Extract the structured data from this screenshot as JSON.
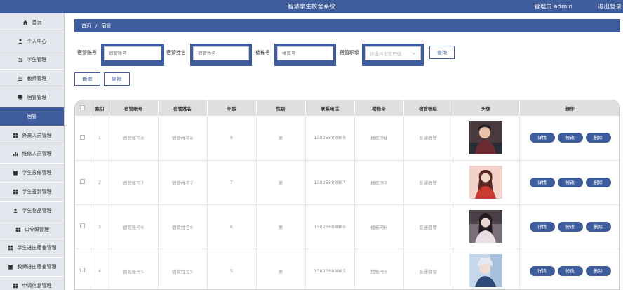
{
  "app": {
    "title": "智慧学生校舍系统",
    "user": "管理员 admin",
    "logout": "退出登录"
  },
  "sidebar": {
    "items": [
      {
        "label": "首页",
        "icon": "home-icon"
      },
      {
        "label": "个人中心",
        "icon": "user-icon"
      },
      {
        "label": "学生管理",
        "icon": "sliders-icon"
      },
      {
        "label": "教师管理",
        "icon": "list-icon"
      },
      {
        "label": "宿管管理",
        "icon": "monitor-icon"
      },
      {
        "label": "宿管",
        "icon": ""
      },
      {
        "label": "外来人员管理",
        "icon": "grid-icon"
      },
      {
        "label": "维修人员管理",
        "icon": "bar-chart-icon"
      },
      {
        "label": "学生报修管理",
        "icon": "clipboard-icon"
      },
      {
        "label": "学生签到管理",
        "icon": "grid-icon"
      },
      {
        "label": "学生物品管理",
        "icon": "user-icon"
      },
      {
        "label": "口令码管理",
        "icon": "grid-icon"
      },
      {
        "label": "学生进出宿舍管理",
        "icon": "grid-icon"
      },
      {
        "label": "教师进出宿舍管理",
        "icon": "clipboard-icon"
      },
      {
        "label": "申请信息管理",
        "icon": "grid-icon"
      }
    ],
    "active_index": 5
  },
  "breadcrumb": {
    "home": "首页",
    "sep": "/",
    "current": "宿管"
  },
  "search": {
    "fields": [
      {
        "label": "宿管账号",
        "placeholder": "宿管账号"
      },
      {
        "label": "宿管姓名",
        "placeholder": "宿管姓名"
      },
      {
        "label": "楼栋号",
        "placeholder": "楼栋号"
      }
    ],
    "level": {
      "label": "宿管职级",
      "placeholder": "请选择宿管职级"
    },
    "query_label": "查询"
  },
  "actions": {
    "add": "新增",
    "delete": "删除"
  },
  "table": {
    "headers": [
      "",
      "索引",
      "宿管账号",
      "宿管姓名",
      "年龄",
      "性别",
      "联系电话",
      "楼栋号",
      "宿管职级",
      "头像",
      "操作"
    ],
    "rows": [
      {
        "index": "1",
        "account": "宿管账号8",
        "name": "宿管姓名8",
        "age": "8",
        "gender": "男",
        "phone": "13823888888",
        "building": "楼栋号8",
        "level": "普通宿管"
      },
      {
        "index": "2",
        "account": "宿管账号7",
        "name": "宿管姓名7",
        "age": "7",
        "gender": "男",
        "phone": "13823888887",
        "building": "楼栋号7",
        "level": "普通宿管"
      },
      {
        "index": "3",
        "account": "宿管账号6",
        "name": "宿管姓名6",
        "age": "6",
        "gender": "男",
        "phone": "13823888886",
        "building": "楼栋号6",
        "level": "普通宿管"
      },
      {
        "index": "4",
        "account": "宿管账号5",
        "name": "宿管姓名5",
        "age": "5",
        "gender": "男",
        "phone": "13823888885",
        "building": "楼栋号5",
        "level": "普通宿管"
      }
    ],
    "op_labels": {
      "detail": "详情",
      "edit": "修改",
      "delete": "删除"
    }
  },
  "colors": {
    "primary": "#3f5d9c",
    "header_bg": "#dfdfdf",
    "sidebar_bg": "#e4e7ee"
  }
}
